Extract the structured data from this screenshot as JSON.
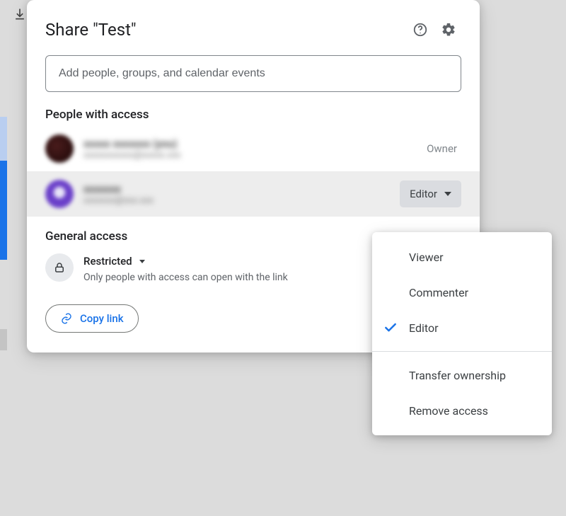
{
  "dialog": {
    "title": "Share \"Test\"",
    "input_placeholder": "Add people, groups, and calendar events",
    "people_section": "People with access",
    "people": [
      {
        "name": "xxxxx xxxxxxx (you)",
        "email": "xxxxxxxxxxx@xxxxx.xxx",
        "role": "Owner"
      },
      {
        "name": "xxxxxxx",
        "email": "xxxxxxx@xxx.xxx",
        "role": "Editor"
      }
    ],
    "general_section": "General access",
    "general": {
      "mode": "Restricted",
      "desc": "Only people with access can open with the link"
    },
    "copy_link": "Copy link"
  },
  "menu": {
    "viewer": "Viewer",
    "commenter": "Commenter",
    "editor": "Editor",
    "transfer": "Transfer ownership",
    "remove": "Remove access",
    "selected": "editor"
  }
}
